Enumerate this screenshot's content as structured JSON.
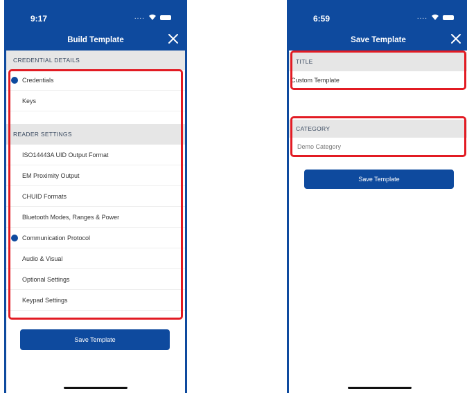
{
  "left_screen": {
    "status_time": "9:17",
    "status_dots": "....",
    "title": "Build Template",
    "credential_section": {
      "label": "CREDENTIAL DETAILS",
      "items": [
        {
          "label": "Credentials",
          "marked": true
        },
        {
          "label": "Keys",
          "marked": false
        }
      ]
    },
    "reader_section": {
      "label": "READER SETTINGS",
      "items": [
        {
          "label": "ISO14443A UID Output Format",
          "marked": false
        },
        {
          "label": "EM Proximity Output",
          "marked": false
        },
        {
          "label": "CHUID Formats",
          "marked": false
        },
        {
          "label": "Bluetooth Modes, Ranges & Power",
          "marked": false
        },
        {
          "label": "Communication Protocol",
          "marked": true
        },
        {
          "label": "Audio & Visual",
          "marked": false
        },
        {
          "label": "Optional Settings",
          "marked": false
        },
        {
          "label": "Keypad Settings",
          "marked": false
        }
      ]
    },
    "save_button_label": "Save Template"
  },
  "right_screen": {
    "status_time": "6:59",
    "status_dots": "....",
    "title": "Save Template",
    "title_field": {
      "label": "TITLE",
      "value": "Custom Template"
    },
    "category_field": {
      "label": "CATEGORY",
      "value": "Demo Category"
    },
    "save_button_label": "Save Template"
  },
  "colors": {
    "brand_blue": "#0e4a9e",
    "highlight_red": "#e21b23",
    "section_gray": "#e6e6e6"
  }
}
